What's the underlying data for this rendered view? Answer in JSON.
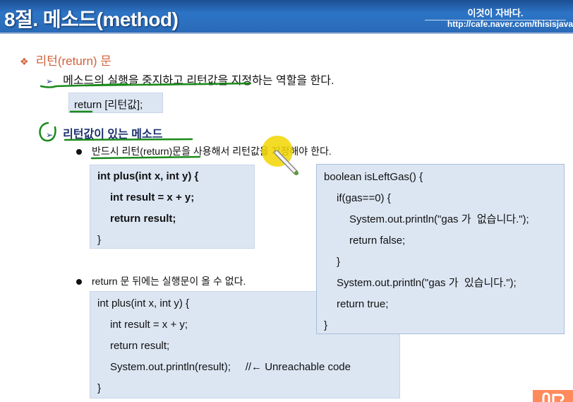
{
  "header": {
    "title": "8절. 메소드(method)",
    "brand": "이것이 자바다.",
    "url": "http://cafe.naver.com/thisisjava"
  },
  "section": {
    "icon": "diamond-bullet-icon",
    "title": "리턴(return) 문"
  },
  "point1": {
    "icon": "arrow-bullet-icon",
    "text": "메소드의 실행을 중지하고 리턴값을 지정하는 역할을 한다."
  },
  "syntax": "return [리턴값];",
  "point2": {
    "icon": "arrow-bullet-icon",
    "text": "리턴값이 있는 메소드"
  },
  "bullet1": "반드시 리턴(return)문을 사용해서 리턴값을 지정해야 한다.",
  "code1": [
    "int plus(int x, int y) {",
    "int result = x + y;",
    "return result;",
    "}"
  ],
  "code2": [
    "boolean isLeftGas() {",
    "if(gas==0) {",
    "System.out.println(\"gas 가  없습니다.\");",
    "return false;",
    "}",
    "System.out.println(\"gas 가  있습니다.\");",
    "return true;",
    "}"
  ],
  "bullet2": "return 문 뒤에는 실행문이 올 수 없다.",
  "code3": [
    "int plus(int x, int y) {",
    "int result = x + y;",
    "return result;",
    "System.out.println(result);     //← Unreachable code",
    "}"
  ],
  "colors": {
    "header": "#2d74c6",
    "section": "#d2603a",
    "codebox": "#dce6f3",
    "annotation": "#1a8a1a",
    "pointer": "#f2d600"
  }
}
